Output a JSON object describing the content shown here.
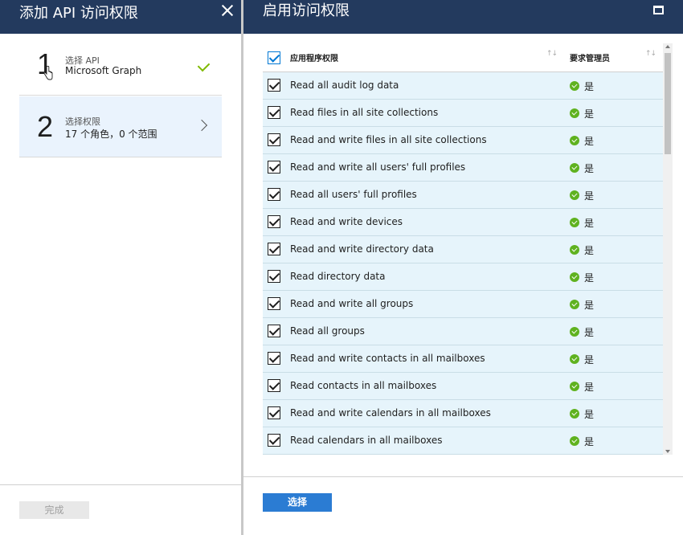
{
  "left_blade": {
    "title": "添加 API 访问权限",
    "steps": [
      {
        "number": "1",
        "subtitle": "选择 API",
        "value": "Microsoft Graph"
      },
      {
        "number": "2",
        "subtitle": "选择权限",
        "value": "17 个角色，0 个范围"
      }
    ],
    "done_label": "完成"
  },
  "right_blade": {
    "title": "启用访问权限",
    "columns": {
      "permission": "应用程序权限",
      "admin": "要求管理员"
    },
    "rows": [
      {
        "name": "Read all audit log data",
        "admin": "是"
      },
      {
        "name": "Read files in all site collections",
        "admin": "是"
      },
      {
        "name": "Read and write files in all site collections",
        "admin": "是"
      },
      {
        "name": "Read and write all users' full profiles",
        "admin": "是"
      },
      {
        "name": "Read all users' full profiles",
        "admin": "是"
      },
      {
        "name": "Read and write devices",
        "admin": "是"
      },
      {
        "name": "Read and write directory data",
        "admin": "是"
      },
      {
        "name": "Read directory data",
        "admin": "是"
      },
      {
        "name": "Read and write all groups",
        "admin": "是"
      },
      {
        "name": "Read all groups",
        "admin": "是"
      },
      {
        "name": "Read and write contacts in all mailboxes",
        "admin": "是"
      },
      {
        "name": "Read contacts in all mailboxes",
        "admin": "是"
      },
      {
        "name": "Read and write calendars in all mailboxes",
        "admin": "是"
      },
      {
        "name": "Read calendars in all mailboxes",
        "admin": "是"
      }
    ],
    "select_label": "选择"
  },
  "colors": {
    "header_bg": "#233a5e",
    "row_bg": "#e6f4fb",
    "accent": "#2b7cd3",
    "ok": "#5fb21f"
  }
}
